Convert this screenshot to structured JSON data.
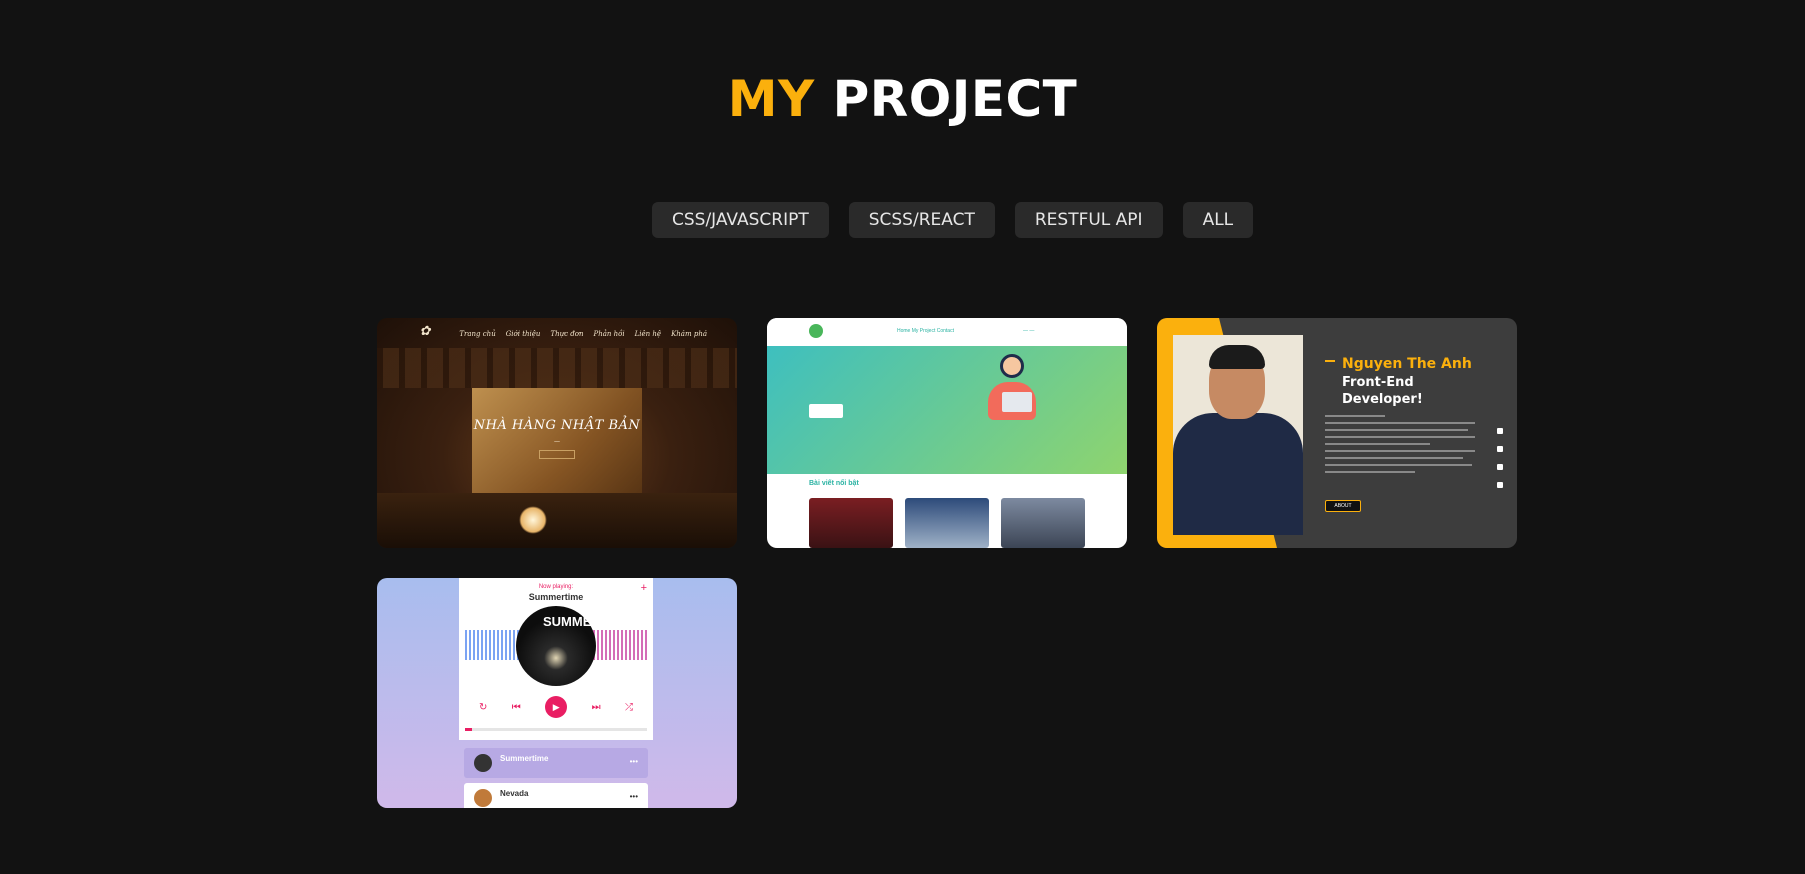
{
  "section": {
    "title_accent": "MY",
    "title_rest": "PROJECT"
  },
  "filters": [
    "CSS/JAVASCRIPT",
    "SCSS/REACT",
    "RESTFUL API",
    "ALL"
  ],
  "projects": {
    "restaurant": {
      "heading": "NHÀ HÀNG NHẬT BẢN",
      "nav": [
        "Trang chủ",
        "Giới thiệu",
        "Thực đơn",
        "Phản hồi",
        "Liên hệ",
        "Khám phá"
      ]
    },
    "learning": {
      "menu": "Home  My Project  Contact",
      "section": "Bài viết nổi bật"
    },
    "portfolio": {
      "name": "Nguyen The Anh",
      "role_line1": "Front-End",
      "role_line2": "Developer!",
      "button": "ABOUT"
    },
    "music": {
      "now_playing": "Now playing:",
      "song": "Summertime",
      "disc_text": "SUMME",
      "playlist": [
        "Summertime",
        "Nevada"
      ]
    }
  },
  "colors": {
    "accent": "#fbb00d",
    "background": "#121212",
    "button_bg": "#2a2a2a"
  }
}
